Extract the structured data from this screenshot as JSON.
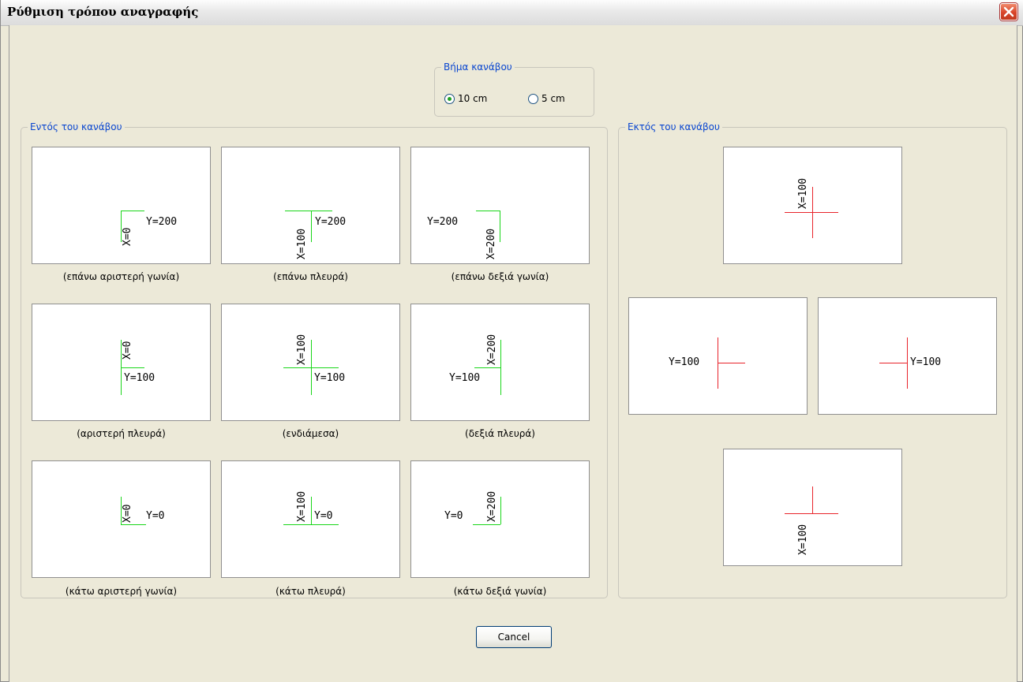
{
  "window": {
    "title": "Ρύθμιση τρόπου αναγραφής"
  },
  "grid_step": {
    "legend": "Βήμα κανάβου",
    "options": [
      {
        "label": "10 cm",
        "selected": true
      },
      {
        "label": "5 cm",
        "selected": false
      }
    ]
  },
  "inside": {
    "legend": "Εντός του κανάβου",
    "tiles": [
      {
        "x_label": "X=0",
        "y_label": "Y=200",
        "caption": "(επάνω αριστερή γωνία)"
      },
      {
        "x_label": "X=100",
        "y_label": "Y=200",
        "caption": "(επάνω πλευρά)"
      },
      {
        "x_label": "X=200",
        "y_label": "Y=200",
        "caption": "(επάνω δεξιά γωνία)"
      },
      {
        "x_label": "X=0",
        "y_label": "Y=100",
        "caption": "(αριστερή πλευρά)"
      },
      {
        "x_label": "X=100",
        "y_label": "Y=100",
        "caption": "(ενδιάμεσα)"
      },
      {
        "x_label": "X=200",
        "y_label": "Y=100",
        "caption": "(δεξιά πλευρά)"
      },
      {
        "x_label": "X=0",
        "y_label": "Y=0",
        "caption": "(κάτω αριστερή γωνία)"
      },
      {
        "x_label": "X=100",
        "y_label": "Y=0",
        "caption": "(κάτω πλευρά)"
      },
      {
        "x_label": "X=200",
        "y_label": "Y=0",
        "caption": "(κάτω δεξιά γωνία)"
      }
    ]
  },
  "outside": {
    "legend": "Εκτός του κανάβου",
    "top_label": "X=100",
    "left_label": "Y=100",
    "right_label": "Y=100",
    "bottom_label": "X=100"
  },
  "buttons": {
    "cancel": "Cancel"
  },
  "colors": {
    "inside_lines": "#19d619",
    "outside_lines": "#e8242b",
    "legend_text": "#0a46d0"
  }
}
